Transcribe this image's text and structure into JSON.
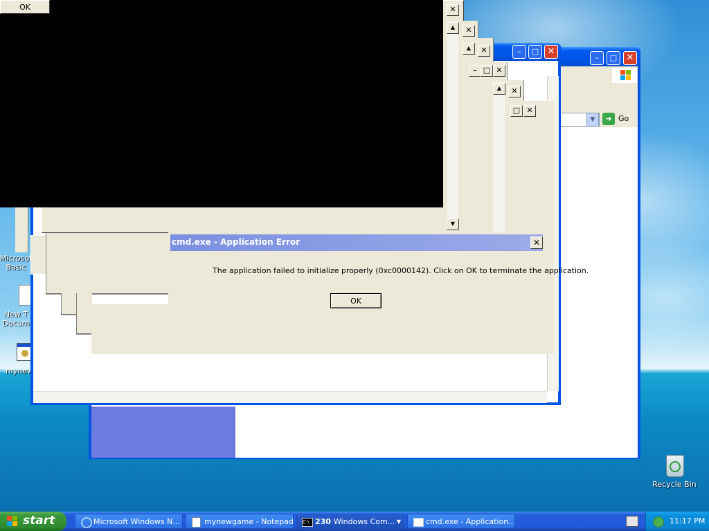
{
  "desktop_icons": [
    {
      "label": "Microsoft\nBasic",
      "icon": "basic-app-icon"
    },
    {
      "label": "New T\nDocum",
      "icon": "text-document-icon"
    },
    {
      "label": "mynew",
      "icon": "exe-app-icon"
    },
    {
      "label": "Recycle Bin",
      "icon": "recycle-bin-icon"
    }
  ],
  "ok_fragment_label": "OK",
  "address_bar": {
    "go_label": "Go"
  },
  "error_dialog": {
    "title": "cmd.exe - Application Error",
    "message": "The application failed to initialize properly (0xc0000142). Click on OK to terminate the application.",
    "ok_label": "OK"
  },
  "taskbar": {
    "start_label": "start",
    "buttons": [
      {
        "label": "Microsoft Windows N...",
        "icon": "ie-icon"
      },
      {
        "label": "mynewgame - Notepad",
        "icon": "notepad-icon"
      },
      {
        "label": "Windows Com...",
        "count": "230",
        "icon": "cmd-icon"
      },
      {
        "label": "cmd.exe - Application...",
        "icon": "window-icon"
      }
    ],
    "clock": "11:17 PM"
  },
  "colors": {
    "error_title_bar": "#8d9fe3",
    "dialog_face": "#ece9d8",
    "taskbar": "#245edb",
    "start_button": "#3a993a"
  }
}
